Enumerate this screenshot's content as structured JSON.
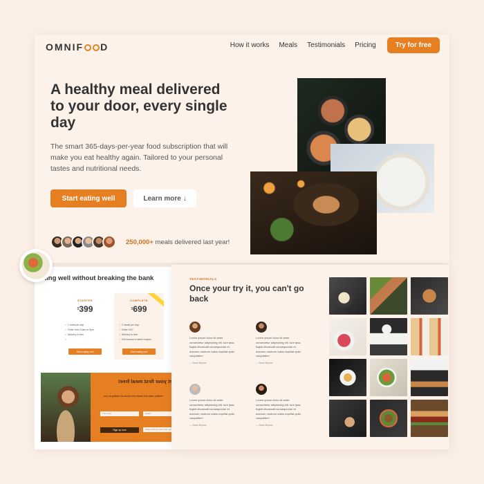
{
  "hero": {
    "logo": {
      "pre": "OMNIF",
      "post": "D"
    },
    "nav": [
      "How it works",
      "Meals",
      "Testimonials",
      "Pricing"
    ],
    "nav_cta": "Try for free",
    "title": "A healthy meal delivered to your door, every single day",
    "description": "The smart 365-days-per-year food subscription that will make you eat healthy again. Tailored to your personal tastes and nutritional needs.",
    "primary_button": "Start eating well",
    "secondary_button": "Learn more ↓",
    "delivered_count": "250,000+",
    "delivered_text": " meals delivered last year!"
  },
  "pricing": {
    "title": "ting well without breaking the bank",
    "plans": [
      {
        "name": "STARTER",
        "currency": "$",
        "price": "399",
        "features": [
          "1 meal per day",
          "Order from 11am to 9pm",
          "Delivery is free",
          ""
        ],
        "button": "Start eating well"
      },
      {
        "name": "COMPLETE",
        "currency": "$",
        "price": "699",
        "features": [
          "2 meals per day",
          "Order 24/7",
          "Delivery is free",
          "Get access to latest recipes"
        ],
        "button": "Start eating well"
      }
    ],
    "promo": {
      "title": "Get your first meal free!",
      "text": "Healthy, tasty and hassle-free meals are waiting for you.",
      "field1": "Full name",
      "field2": "Email",
      "field3": "Where did you hear from us?",
      "button": "Sign up now"
    }
  },
  "testimonials": {
    "subheading": "TESTIMONIALS",
    "title": "Once your try it, you can't go back",
    "items": [
      {
        "text": "Lorem ipsum dolor sit amet consectetur adipisicing elit. Iure ipsa, fugiat obcaecati consequuntur et dolorum nostrum natus repellat optio voluptatem",
        "name": "— Dave Bryson"
      },
      {
        "text": "Lorem ipsum dolor sit amet consectetur adipisicing elit. Iure ipsa, fugiat obcaecati consequuntur et dolorum nostrum natus repellat optio voluptatem",
        "name": "— Dave Bryson"
      },
      {
        "text": "Lorem ipsum dolor sit amet consectetur adipisicing elit. Iure ipsa, fugiat obcaecati consequuntur et dolorum nostrum natus repellat optio voluptatem",
        "name": "— Dave Bryson"
      },
      {
        "text": "Lorem ipsum dolor sit amet consectetur adipisicing elit. Iure ipsa, fugiat obcaecati consequuntur et dolorum nostrum natus repellat optio voluptatem",
        "name": "— Dave Bryson"
      }
    ]
  },
  "colors": {
    "accent": "#e67e22",
    "accent_dark": "#cf711f",
    "background": "#fdf2e9",
    "text": "#333333"
  }
}
